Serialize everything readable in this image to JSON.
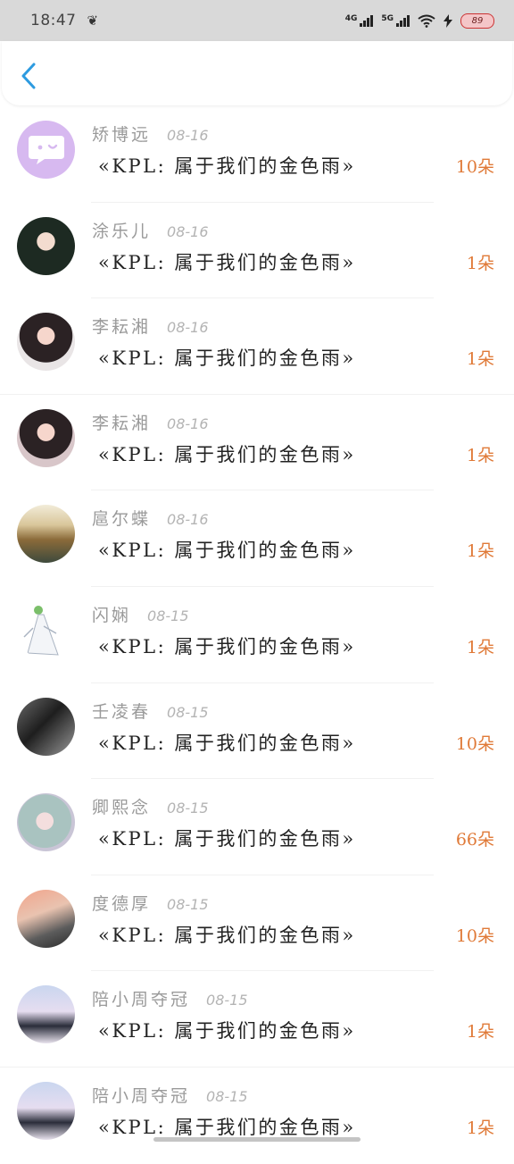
{
  "status_bar": {
    "time": "18:47",
    "network_1": "4G",
    "network_2": "5G",
    "battery": "89"
  },
  "items": [
    {
      "name": "矫博远",
      "date": "08-16",
      "title": "«KPL: 属于我们的金色雨»",
      "count": "10朵",
      "avatar_icon": "chat-bubble-icon"
    },
    {
      "name": "涂乐儿",
      "date": "08-16",
      "title": "«KPL: 属于我们的金色雨»",
      "count": "1朵"
    },
    {
      "name": "李耘湘",
      "date": "08-16",
      "title": "«KPL: 属于我们的金色雨»",
      "count": "1朵"
    },
    {
      "name": "李耘湘",
      "date": "08-16",
      "title": "«KPL: 属于我们的金色雨»",
      "count": "1朵"
    },
    {
      "name": "扈尔蝶",
      "date": "08-16",
      "title": "«KPL: 属于我们的金色雨»",
      "count": "1朵"
    },
    {
      "name": "闪娴",
      "date": "08-15",
      "title": "«KPL: 属于我们的金色雨»",
      "count": "1朵"
    },
    {
      "name": "壬凌春",
      "date": "08-15",
      "title": "«KPL: 属于我们的金色雨»",
      "count": "10朵"
    },
    {
      "name": "卿熙念",
      "date": "08-15",
      "title": "«KPL: 属于我们的金色雨»",
      "count": "66朵"
    },
    {
      "name": "度德厚",
      "date": "08-15",
      "title": "«KPL: 属于我们的金色雨»",
      "count": "10朵"
    },
    {
      "name": "陪小周夺冠",
      "date": "08-15",
      "title": "«KPL: 属于我们的金色雨»",
      "count": "1朵"
    },
    {
      "name": "陪小周夺冠",
      "date": "08-15",
      "title": "«KPL: 属于我们的金色雨»",
      "count": "1朵"
    }
  ],
  "colors": {
    "accent_blue": "#2d9be0",
    "count_orange": "#e07a38",
    "status_bar_bg": "#d9d9d9"
  }
}
